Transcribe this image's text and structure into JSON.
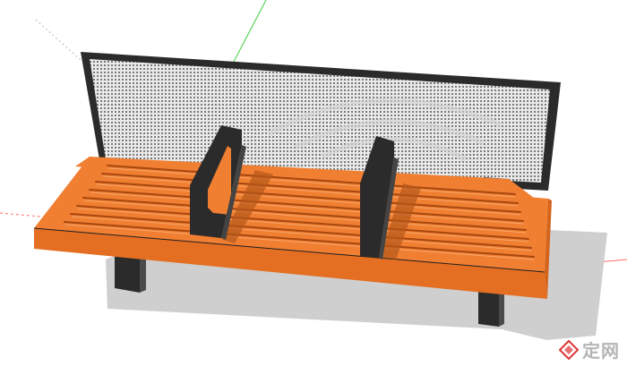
{
  "scene": {
    "subject": "bench",
    "background_color": "#ffffff",
    "colors": {
      "seat": "#f07f32",
      "seat_slot": "#c85c1a",
      "frame": "#2b2b2b",
      "mesh": "#8c8c8c",
      "shadow": "#cfcfcf",
      "axis_red": "#ff4b4b",
      "axis_green": "#3ccf3c"
    }
  },
  "watermark": {
    "text": "定网",
    "logo": "diamond-logo-icon"
  }
}
